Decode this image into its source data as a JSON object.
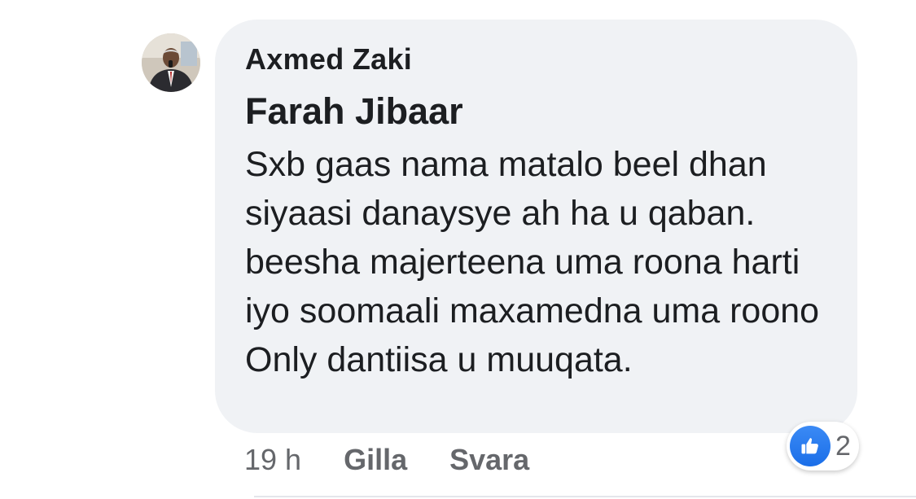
{
  "comment": {
    "author": "Axmed Zaki",
    "tagged_name": "Farah Jibaar",
    "text": "Sxb gaas nama matalo beel dhan siyaasi danaysye ah ha u qaban. beesha majerteena uma roona harti iyo soomaali maxamedna uma roono Only dantiisa u muuqata.",
    "timestamp": "19 h",
    "like_label": "Gilla",
    "reply_label": "Svara",
    "reaction_icon": "thumbs-up-icon",
    "reaction_count": "2"
  },
  "colors": {
    "bubble_bg": "#f0f2f5",
    "text": "#1c1e21",
    "muted": "#65676b",
    "like_blue": "#1a6ee8"
  }
}
